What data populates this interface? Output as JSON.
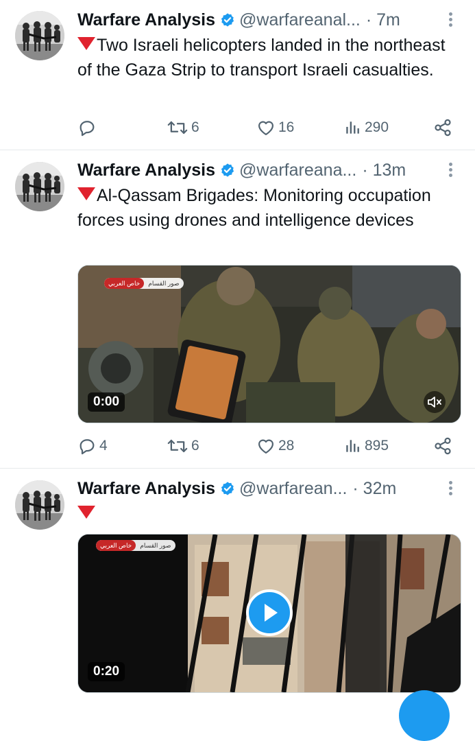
{
  "tweets": [
    {
      "name": "Warfare Analysis",
      "handle": "@warfareanal...",
      "time": "· 7m",
      "text": "Two Israeli helicopters landed in the northeast of the Gaza Strip to transport Israeli casualties.",
      "replies": "",
      "retweets": "6",
      "likes": "16",
      "views": "290"
    },
    {
      "name": "Warfare Analysis",
      "handle": "@warfareana...",
      "time": "· 13m",
      "text": "Al-Qassam Brigades: Monitoring occupation forces using drones and intelligence devices",
      "media": {
        "type": "video",
        "duration": "0:00",
        "watermark_left": "خاص العربي",
        "watermark_right": "صور القسام"
      },
      "replies": "4",
      "retweets": "6",
      "likes": "28",
      "views": "895"
    },
    {
      "name": "Warfare Analysis",
      "handle": "@warfarean...",
      "time": "· 32m",
      "text": "",
      "media": {
        "type": "video",
        "duration": "0:20",
        "watermark_left": "خاص العربي",
        "watermark_right": "صور القسام"
      }
    }
  ],
  "icons": {
    "verified": "verified-badge-icon",
    "reply": "reply-icon",
    "retweet": "retweet-icon",
    "like": "heart-icon",
    "views": "views-icon",
    "share": "share-icon",
    "more": "more-icon",
    "alert": "red-triangle-emoji"
  },
  "colors": {
    "accent": "#1d9bf0",
    "secondary_text": "#536471",
    "divider": "#e6e9ec",
    "alert_red": "#e0232e"
  }
}
